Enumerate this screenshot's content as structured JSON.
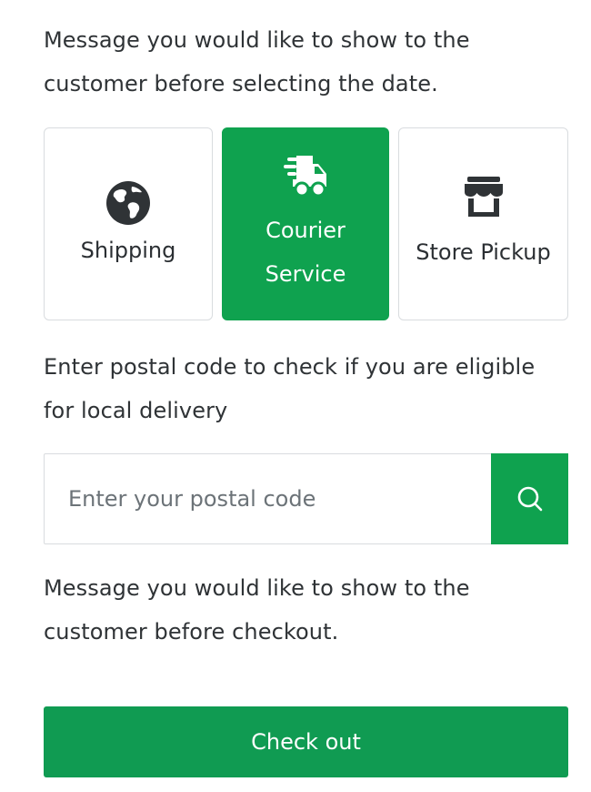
{
  "messages": {
    "before_date": "Message you would like to show to the customer before selecting the date.",
    "postal_prompt": "Enter postal code to check if you are eligible for local delivery",
    "before_checkout": "Message you would like to show to the customer before checkout."
  },
  "delivery_options": [
    {
      "label": "Shipping",
      "icon": "globe-icon",
      "selected": false
    },
    {
      "label": "Courier Service",
      "icon": "truck-icon",
      "selected": true
    },
    {
      "label": "Store Pickup",
      "icon": "store-icon",
      "selected": false
    }
  ],
  "postal": {
    "placeholder": "Enter your postal code",
    "value": "",
    "search_icon": "search-icon"
  },
  "checkout": {
    "label": "Check out"
  },
  "colors": {
    "accent": "#0fa24f",
    "text": "#2f3336",
    "border": "#d9dcdf"
  }
}
